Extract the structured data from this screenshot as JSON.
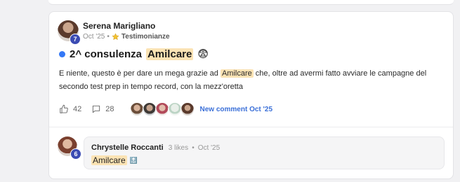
{
  "post": {
    "author": "Serena Marigliano",
    "author_level": "7",
    "date": "Oct '25",
    "separator": "•",
    "category": "Testimonianze",
    "title_prefix": "2^ consulenza",
    "title_highlight": "Amilcare",
    "title_emoji": "😨",
    "body_before": "E niente, questo è per dare un mega grazie ad ",
    "body_highlight": "Amilcare",
    "body_after": " che, oltre ad avermi fatto avviare le campagne del secondo test prep in tempo record, con la mezz'oretta",
    "likes": "42",
    "comments": "28",
    "new_comment": "New comment Oct '25",
    "icons": {
      "like": "thumbs-up-icon",
      "comment": "speech-bubble-icon",
      "category": "star-icon"
    }
  },
  "comment": {
    "author": "Chrystelle Roccanti",
    "author_level": "6",
    "likes_text": "3 likes",
    "separator": "•",
    "date": "Oct '25",
    "text_highlight": "Amilcare",
    "emoji_label": "🔝"
  },
  "colors": {
    "accent": "#3a6fd8",
    "highlight": "#fbe3b4",
    "level_badge": "#3b4bb3",
    "status_dot": "#3478f6"
  }
}
